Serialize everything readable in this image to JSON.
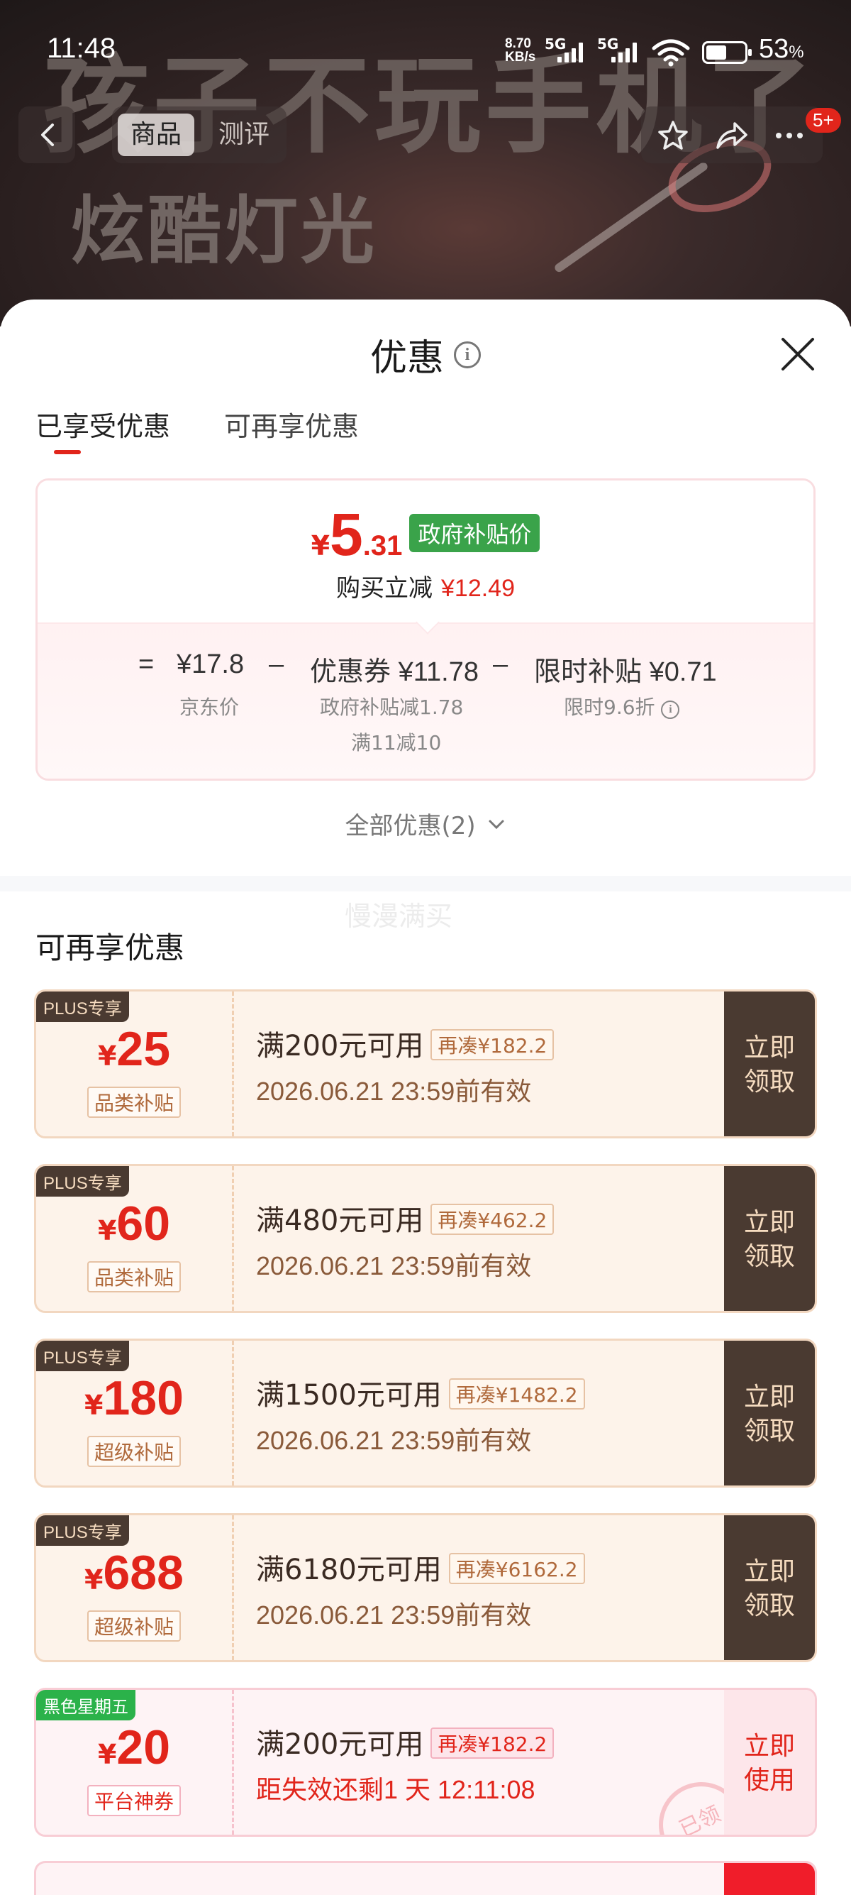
{
  "status_bar": {
    "time": "11:48",
    "net_speed_top": "8.70",
    "net_speed_unit": "KB/s",
    "net_type_1": "5G",
    "net_type_2": "5G",
    "battery_percent": "53",
    "battery_unit": "%"
  },
  "hero": {
    "big_text": "孩子不玩手机了",
    "sub_text": "炫酷灯光"
  },
  "nav": {
    "tab_product": "商品",
    "tab_review": "测评",
    "more_badge": "5+"
  },
  "sheet": {
    "title": "优惠",
    "tabs": [
      "已享受优惠",
      "可再享优惠"
    ],
    "summary": {
      "yen": "¥",
      "price_int": "5",
      "price_dec": ".31",
      "price_tag": "政府补贴价",
      "reduce_label": "购买立减",
      "reduce_amount": "¥12.49",
      "eq": "=",
      "minus": "–",
      "jd_price": "¥17.8",
      "jd_price_label": "京东价",
      "coupon_label": "优惠券",
      "coupon_amount": "¥11.78",
      "coupon_sub1": "政府补贴减1.78",
      "coupon_sub2": "满11减10",
      "limit_label": "限时补贴",
      "limit_amount": "¥0.71",
      "limit_sub": "限时9.6折"
    },
    "all_offers": "全部优惠(2)",
    "watermark": "慢漫满买",
    "section_title": "可再享优惠"
  },
  "coupons": [
    {
      "tag": "PLUS专享",
      "yen": "¥",
      "amount": "25",
      "type": "品类补贴",
      "condition": "满200元可用",
      "need": "再凑¥182.2",
      "valid": "2026.06.21 23:59前有效",
      "button_1": "立即",
      "button_2": "领取"
    },
    {
      "tag": "PLUS专享",
      "yen": "¥",
      "amount": "60",
      "type": "品类补贴",
      "condition": "满480元可用",
      "need": "再凑¥462.2",
      "valid": "2026.06.21 23:59前有效",
      "button_1": "立即",
      "button_2": "领取"
    },
    {
      "tag": "PLUS专享",
      "yen": "¥",
      "amount": "180",
      "type": "超级补贴",
      "condition": "满1500元可用",
      "need": "再凑¥1482.2",
      "valid": "2026.06.21 23:59前有效",
      "button_1": "立即",
      "button_2": "领取"
    },
    {
      "tag": "PLUS专享",
      "yen": "¥",
      "amount": "688",
      "type": "超级补贴",
      "condition": "满6180元可用",
      "need": "再凑¥6162.2",
      "valid": "2026.06.21 23:59前有效",
      "button_1": "立即",
      "button_2": "领取"
    },
    {
      "tag": "黑色星期五",
      "yen": "¥",
      "amount": "20",
      "type": "平台神券",
      "condition": "满200元可用",
      "need": "再凑¥182.2",
      "valid": "距失效还剩1 天 12:11:08",
      "button_1": "立即",
      "button_2": "使用",
      "stamp": "已领"
    }
  ],
  "colors": {
    "accent_red": "#e1251b",
    "gov_green": "#3aa34a",
    "plus_brown": "#4a3a31"
  }
}
